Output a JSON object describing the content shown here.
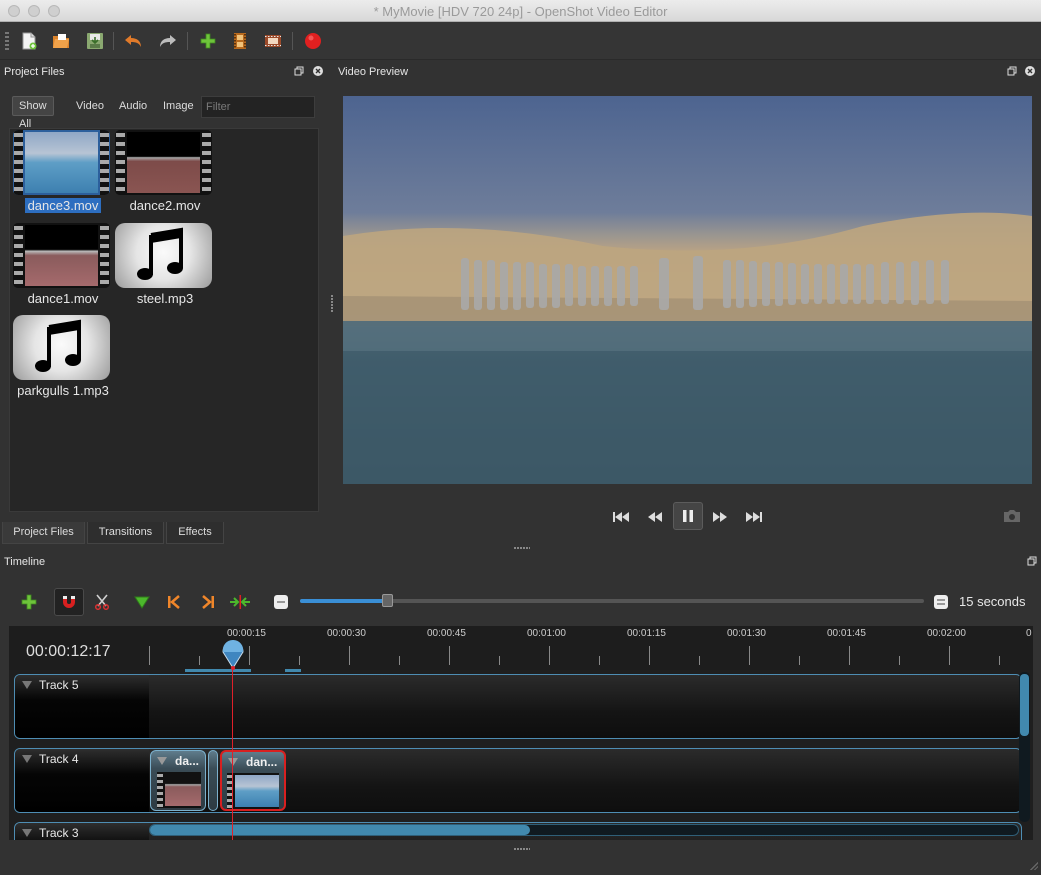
{
  "window": {
    "title": "* MyMovie [HDV 720 24p] - OpenShot Video Editor"
  },
  "toolbar": {
    "icons": [
      "new-project-icon",
      "open-project-icon",
      "save-project-icon",
      "undo-icon",
      "redo-icon",
      "import-files-icon",
      "choose-profile-icon",
      "fullscreen-icon",
      "export-video-icon"
    ],
    "colors": {
      "undo": "#e07a2a",
      "import": "#6ec43b",
      "export": "#e02020"
    }
  },
  "project_files": {
    "title": "Project Files",
    "filters": [
      "Show All",
      "Video",
      "Audio",
      "Image"
    ],
    "active_filter": "Show All",
    "filter_placeholder": "Filter",
    "files": [
      {
        "name": "dance3.mov",
        "kind": "video",
        "selected": true
      },
      {
        "name": "dance2.mov",
        "kind": "video",
        "selected": false
      },
      {
        "name": "dance1.mov",
        "kind": "video",
        "selected": false
      },
      {
        "name": "steel.mp3",
        "kind": "audio",
        "selected": false
      },
      {
        "name": "parkgulls 1.mp3",
        "kind": "audio",
        "selected": false
      }
    ]
  },
  "dock_tabs": [
    "Project Files",
    "Transitions",
    "Effects"
  ],
  "video_preview": {
    "title": "Video Preview",
    "controls": [
      "jump-start-icon",
      "rewind-icon",
      "pause-icon",
      "fast-forward-icon",
      "jump-end-icon"
    ]
  },
  "timeline": {
    "title": "Timeline",
    "current_time": "00:00:12:17",
    "zoom_label": "15 seconds",
    "zoom_level": 0.14,
    "ruler_labels": [
      "00:00:15",
      "00:00:30",
      "00:00:45",
      "00:01:00",
      "00:01:15",
      "00:01:30",
      "00:01:45",
      "00:02:00",
      "0"
    ],
    "tracks": [
      {
        "name": "Track 5",
        "clips": []
      },
      {
        "name": "Track 4",
        "clips": [
          {
            "title": "da...",
            "source": "dance1.mov",
            "selected": false
          },
          {
            "title": "dan...",
            "source": "dance3.mov",
            "selected": true
          }
        ]
      },
      {
        "name": "Track 3",
        "clips": []
      }
    ],
    "colors": {
      "track_border": "#4e8db3",
      "playhead": "#e0202a",
      "selected_clip": "#d82020"
    }
  }
}
